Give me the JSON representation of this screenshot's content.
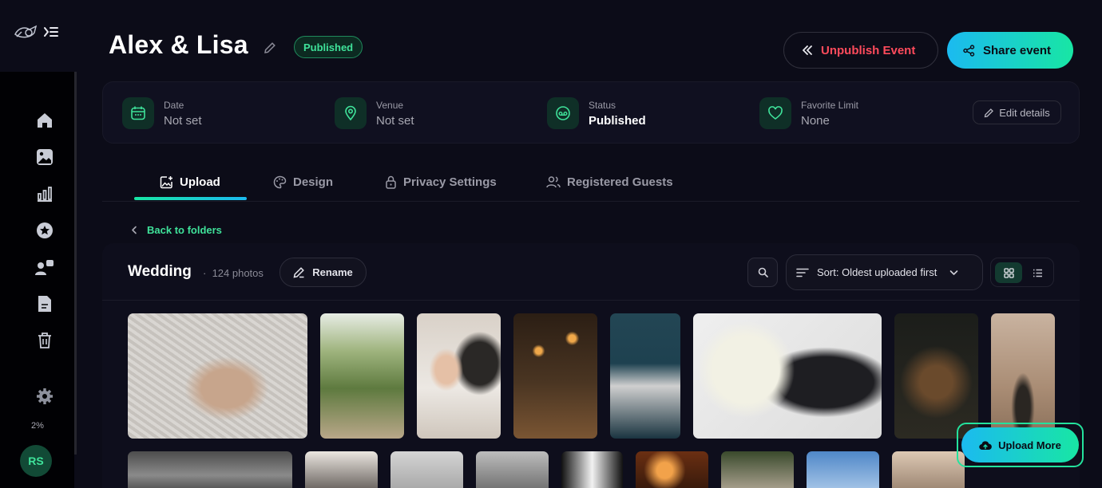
{
  "sidebar": {
    "nav": [
      {
        "name": "home",
        "icon": "home-icon"
      },
      {
        "name": "gallery",
        "icon": "image-icon"
      },
      {
        "name": "analytics",
        "icon": "bar-chart-icon"
      },
      {
        "name": "favorites",
        "icon": "star-icon"
      },
      {
        "name": "guests",
        "icon": "users-icon"
      },
      {
        "name": "documents",
        "icon": "document-icon"
      },
      {
        "name": "trash",
        "icon": "trash-icon"
      }
    ],
    "settings_icon": "gear-icon",
    "storage_percent": "2%",
    "avatar_initials": "RS"
  },
  "header": {
    "title": "Alex & Lisa",
    "status_badge": "Published",
    "unpublish_label": "Unpublish Event",
    "share_label": "Share event"
  },
  "info": {
    "date_label": "Date",
    "date_value": "Not set",
    "venue_label": "Venue",
    "venue_value": "Not set",
    "status_label": "Status",
    "status_value": "Published",
    "favorite_label": "Favorite Limit",
    "favorite_value": "None",
    "edit_label": "Edit details"
  },
  "tabs": [
    {
      "label": "Upload",
      "icon": "upload-image-icon",
      "active": true
    },
    {
      "label": "Design",
      "icon": "palette-icon",
      "active": false
    },
    {
      "label": "Privacy Settings",
      "icon": "lock-icon",
      "active": false
    },
    {
      "label": "Registered Guests",
      "icon": "users-icon",
      "active": false
    }
  ],
  "back_label": "Back to folders",
  "folder": {
    "name": "Wedding",
    "count": "124 photos",
    "rename_label": "Rename",
    "sort_label": "Sort: Oldest uploaded first",
    "view_mode": "grid"
  },
  "upload_more_label": "Upload More",
  "colors": {
    "accent_green": "#3fe29a",
    "accent_cyan": "#1bbaf0",
    "danger": "#ff4b5c",
    "background": "#0c0c18"
  }
}
